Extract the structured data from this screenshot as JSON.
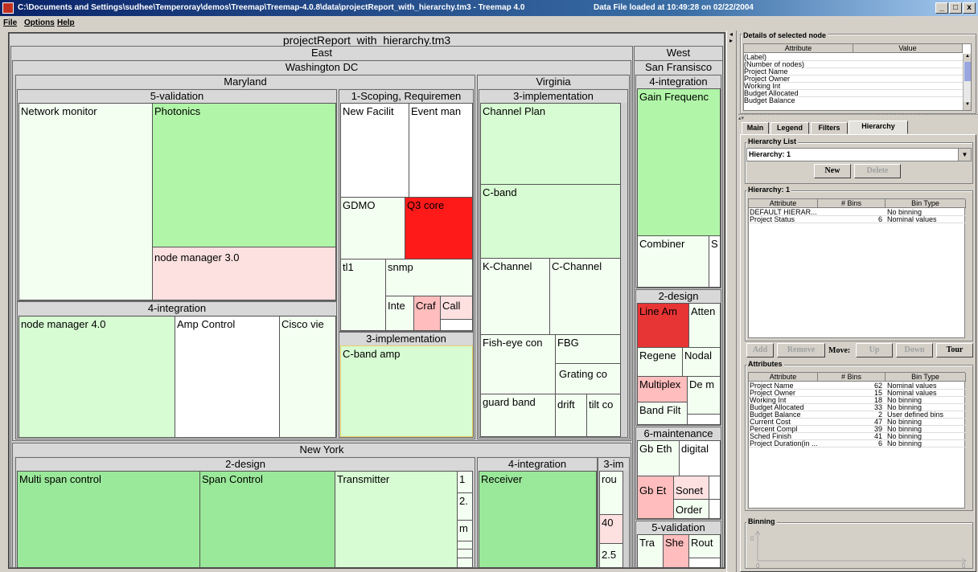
{
  "window": {
    "title": "C:\\Documents and Settings\\sudhee\\Temperoray\\demos\\Treemap\\Treemap-4.0.8\\data\\projectReport_with_hierarchy.tm3 - Treemap 4.0",
    "status": "Data File loaded at 10:49:28 on 02/22/2004",
    "min": "_",
    "max": "□",
    "close": "x"
  },
  "menu": {
    "file": "File",
    "options": "Options",
    "help": "Help"
  },
  "treemap": {
    "root": "projectReport_with_hierarchy.tm3",
    "east": "East",
    "west": "West",
    "wdc": "Washington DC",
    "maryland": "Maryland",
    "virginia": "Virginia",
    "newyork": "New York",
    "sanfran": "San Fransisco",
    "md": {
      "validation": "5-validation",
      "scoping": "1-Scoping, Requiremen",
      "integration": "4-integration",
      "implementation": "3-implementation",
      "network_monitor": "Network monitor",
      "photonics": "Photonics",
      "node_manager_3": "node manager 3.0",
      "new_facilit": "New Facilit",
      "event_man": "Event man",
      "gdmo": "GDMO",
      "q3_core": "Q3 core",
      "tl1": "tl1",
      "snmp": "snmp",
      "inte": "Inte",
      "craf": "Craf",
      "call": "Call",
      "node_manager_4": "node manager 4.0",
      "amp_control": "Amp Control",
      "cisco_vie": "Cisco vie",
      "cband_amp": "C-band amp"
    },
    "va": {
      "implementation": "3-implementation",
      "channel_plan": "Channel Plan",
      "cband": "C-band",
      "kchannel": "K-Channel",
      "cchannel": "C-Channel",
      "fisheye": "Fish-eye con",
      "fbg": "FBG",
      "grating": "Grating co",
      "guard_band": "guard band",
      "drift": "drift",
      "tilt": "tilt co"
    },
    "ny": {
      "design": "2-design",
      "integration": "4-integration",
      "impl": "3-im",
      "multi_span": "Multi span control",
      "span_control": "Span Control",
      "transmitter": "Transmitter",
      "one": "1",
      "two": "2.",
      "m": "m",
      "receiver": "Receiver",
      "rou": "rou",
      "forty": "40",
      "twofive": "2.5"
    },
    "sf": {
      "integration": "4-integration",
      "design": "2-design",
      "maintenance": "6-maintenance",
      "validation": "5-validation",
      "gain": "Gain Frequenc",
      "combiner": "Combiner",
      "s": "S",
      "line_am": "Line Am",
      "atten": "Atten",
      "regene": "Regene",
      "nodal": "Nodal",
      "multiplex": "Multiplex",
      "dem": "De m",
      "band_filt": "Band Filt",
      "gb_eth": "Gb Eth",
      "digital": "digital",
      "gb_et": "Gb Et",
      "sonet": "Sonet",
      "order": "Order",
      "tra": "Tra",
      "she": "She",
      "rout": "Rout"
    }
  },
  "details": {
    "title": "Details of selected node",
    "col_attr": "Attribute",
    "col_value": "Value",
    "rows": [
      "(Label)",
      "(Number of nodes)",
      "Project Name",
      "Project Owner",
      "Working Int",
      "Budget Allocated",
      "Budget Balance"
    ]
  },
  "tabs": {
    "main": "Main",
    "legend": "Legend",
    "filters": "Filters",
    "hierarchy": "Hierarchy"
  },
  "hierarchy_list": {
    "label": "Hierarchy List",
    "selected": "Hierarchy: 1",
    "new": "New",
    "delete": "Delete"
  },
  "hierarchy1": {
    "label": "Hierarchy: 1",
    "col_attr": "Attribute",
    "col_bins": "# Bins",
    "col_type": "Bin Type",
    "rows": [
      {
        "attr": "DEFAULT HIERAR...",
        "bins": "",
        "type": "No binning"
      },
      {
        "attr": "Project Status",
        "bins": "6",
        "type": "Nominal values"
      }
    ]
  },
  "movebar": {
    "add": "Add",
    "remove": "Remove",
    "move": "Move:",
    "up": "Up",
    "down": "Down",
    "tour": "Tour"
  },
  "attributes": {
    "label": "Attributes",
    "col_attr": "Attribute",
    "col_bins": "# Bins",
    "col_type": "Bin Type",
    "rows": [
      {
        "attr": "Project Name",
        "bins": "62",
        "type": "Nominal values"
      },
      {
        "attr": "Project Owner",
        "bins": "15",
        "type": "Nominal values"
      },
      {
        "attr": "Working Int",
        "bins": "18",
        "type": "No binning"
      },
      {
        "attr": "Budget Allocated",
        "bins": "33",
        "type": "No binning"
      },
      {
        "attr": "Budget Balance",
        "bins": "2",
        "type": "User defined bins"
      },
      {
        "attr": "Current Cost",
        "bins": "47",
        "type": "No binning"
      },
      {
        "attr": "Percent Compl",
        "bins": "39",
        "type": "No binning"
      },
      {
        "attr": "Sched Finish",
        "bins": "41",
        "type": "No binning"
      },
      {
        "attr": "Project Duration(in ...",
        "bins": "6",
        "type": "No binning"
      }
    ]
  },
  "binning": {
    "label": "Binning",
    "y0": "0",
    "x0": "0",
    "x1": "0"
  }
}
